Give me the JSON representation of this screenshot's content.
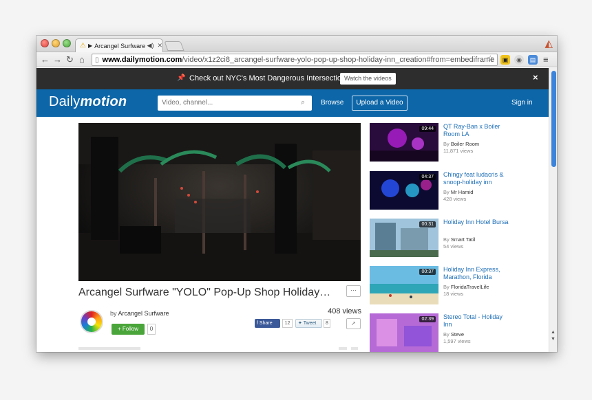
{
  "browser": {
    "tab_title": "Arcangel Surfware \"Y",
    "url_host": "www.dailymotion.com",
    "url_path": "/video/x1z2ci8_arcangel-surfware-yolo-pop-up-shop-holiday-inn_creation#from=embediframe"
  },
  "promo": {
    "message": "Check out NYC's Most Dangerous Intersections",
    "button": "Watch the videos",
    "close": "×"
  },
  "header": {
    "logo_regular": "Daily",
    "logo_bold": "motion",
    "search_placeholder": "Video, channel...",
    "browse": "Browse",
    "upload": "Upload a Video",
    "signin": "Sign in"
  },
  "video": {
    "title": "Arcangel Surfware \"YOLO\" Pop-Up Shop Holiday…",
    "more": "⋯",
    "by_prefix": "by",
    "owner": "Arcangel Surfware",
    "views": "408 views",
    "follow": "+ Follow",
    "follow_count": "0",
    "share": "Share",
    "share_count": "12",
    "tweet": "Tweet",
    "tweet_count": "8"
  },
  "related": [
    {
      "duration": "09:44",
      "title": "QT Ray-Ban x Boiler Room LA",
      "by": "By",
      "author": "Boiler Room",
      "views": "11,871 views"
    },
    {
      "duration": "04:37",
      "title": "Chingy feat ludacris & snoop-holiday inn",
      "by": "By",
      "author": "Mr Hamid",
      "views": "428 views"
    },
    {
      "duration": "00:31",
      "title": "Holiday Inn Hotel Bursa",
      "by": "By",
      "author": "Smart Tatil",
      "views": "54 views"
    },
    {
      "duration": "00:37",
      "title": "Holiday Inn Express, Marathon, Florida",
      "by": "By",
      "author": "FloridaTravelLife",
      "views": "18 views"
    },
    {
      "duration": "02:39",
      "title": "Stereo Total - Holiday Inn",
      "by": "By",
      "author": "Steve",
      "views": "1,597 views"
    }
  ],
  "colors": {
    "brand_blue": "#0d66a8",
    "link_blue": "#1f6fb7",
    "follow_green": "#4aa53a"
  }
}
